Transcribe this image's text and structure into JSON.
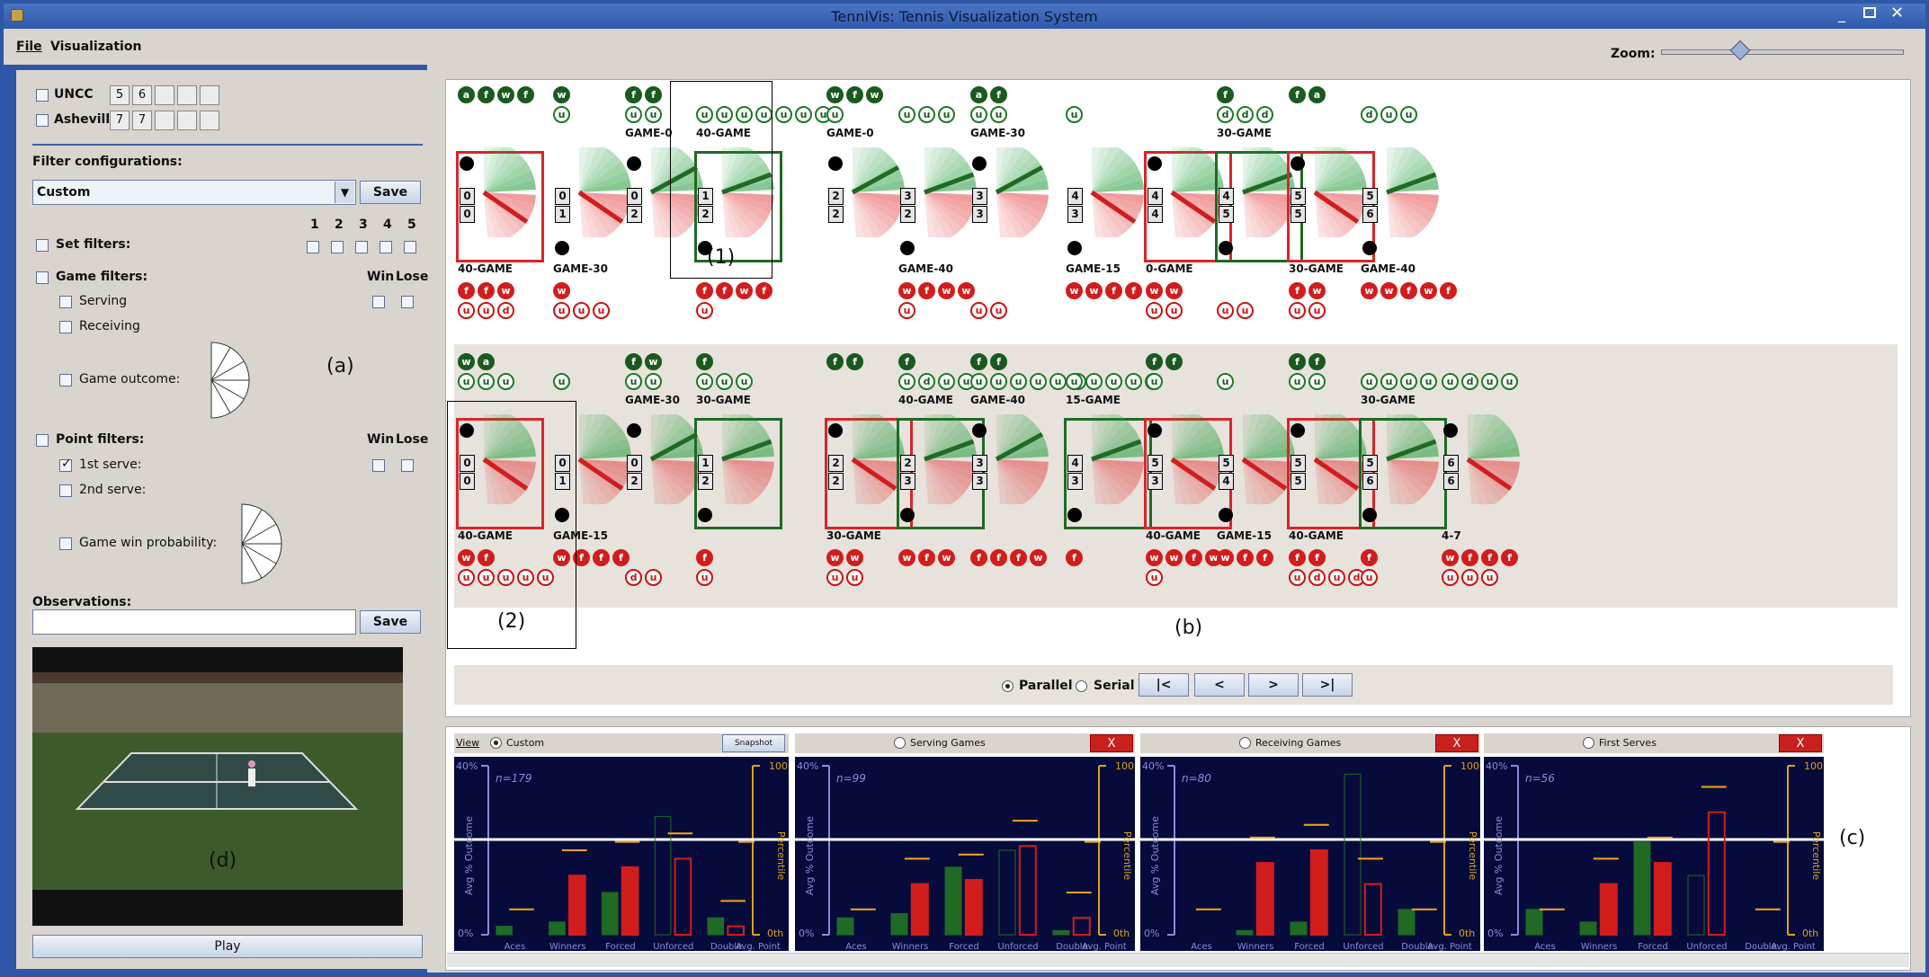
{
  "window": {
    "title": "TenniVis:  Tennis Visualization System"
  },
  "menu": {
    "file": "File",
    "visualization": "Visualization",
    "zoom_label": "Zoom:",
    "zoom_level": 0.28
  },
  "players": [
    {
      "name": "UNCC",
      "sets": [
        "5",
        "6",
        "",
        "",
        ""
      ]
    },
    {
      "name": "Asheville",
      "sets": [
        "7",
        "7",
        "",
        "",
        ""
      ]
    }
  ],
  "filters": {
    "config_label": "Filter configurations:",
    "config_value": "Custom",
    "save": "Save",
    "set_numbers": [
      "1",
      "2",
      "3",
      "4",
      "5"
    ],
    "set_filters": "Set filters:",
    "game_filters": "Game filters:",
    "win": "Win",
    "lose": "Lose",
    "serving": "Serving",
    "receiving": "Receiving",
    "game_outcome": "Game outcome:",
    "point_filters": "Point filters:",
    "first_serve": "1st serve:",
    "second_serve": "2nd serve:",
    "game_win_prob": "Game win probability:",
    "observations": "Observations:",
    "obs_save": "Save",
    "play": "Play"
  },
  "annotations": {
    "a": "(a)",
    "b": "(b)",
    "c": "(c)",
    "d": "(d)",
    "one": "(1)",
    "two": "(2)"
  },
  "colors": {
    "win": "#1a5a1f",
    "lose": "#d21d1d",
    "bg": "#d9d4ce"
  },
  "sets": [
    {
      "games": [
        {
          "x": 372,
          "top": [
            "a",
            "f",
            "w",
            "f"
          ],
          "topO": [],
          "title": "",
          "score": [
            "0",
            "0"
          ],
          "box": "r",
          "serveTop": true,
          "bottomLbl": "40-GAME",
          "bot": [
            "f",
            "f",
            "w"
          ],
          "botO": [
            "u",
            "u",
            "d"
          ],
          "fan": "rd"
        },
        {
          "x": 478,
          "top": [
            "w"
          ],
          "topO": [
            "u"
          ],
          "title": "",
          "score": [
            "0",
            "1"
          ],
          "box": "",
          "serveTop": false,
          "bottomLbl": "GAME-30",
          "bot": [
            "w"
          ],
          "botO": [
            "u",
            "u",
            "u"
          ],
          "fan": "rd"
        },
        {
          "x": 558,
          "top": [
            "f",
            "f"
          ],
          "topO": [
            "u",
            "u"
          ],
          "title": "GAME-0",
          "score": [
            "0",
            "2"
          ],
          "box": "",
          "serveTop": true,
          "bottomLbl": "",
          "bot": [],
          "botO": [],
          "fan": "gu"
        },
        {
          "x": 637,
          "top": [],
          "topO": [
            "u",
            "u",
            "u",
            "u",
            "u",
            "u",
            "u"
          ],
          "title": "40-GAME",
          "score": [
            "1",
            "2"
          ],
          "box": "g",
          "serveTop": false,
          "bottomLbl": "",
          "bot": [
            "f",
            "f",
            "w",
            "f"
          ],
          "botO": [
            "u"
          ],
          "fan": "gl"
        },
        {
          "x": 782,
          "top": [
            "w",
            "f",
            "w"
          ],
          "topO": [
            "u"
          ],
          "title": "GAME-0",
          "score": [
            "2",
            "2"
          ],
          "box": "",
          "serveTop": true,
          "bottomLbl": "",
          "bot": [],
          "botO": [],
          "fan": "gu"
        },
        {
          "x": 862,
          "top": [],
          "topO": [
            "u",
            "u",
            "u"
          ],
          "title": "",
          "score": [
            "3",
            "2"
          ],
          "box": "",
          "serveTop": false,
          "bottomLbl": "GAME-40",
          "bot": [
            "w",
            "f",
            "w",
            "w"
          ],
          "botO": [
            "u"
          ],
          "fan": "gl"
        },
        {
          "x": 942,
          "top": [
            "a",
            "f"
          ],
          "topO": [
            "u",
            "u"
          ],
          "title": "GAME-30",
          "score": [
            "3",
            "3"
          ],
          "box": "",
          "serveTop": true,
          "bottomLbl": "",
          "bot": [],
          "botO": [
            "u",
            "u"
          ],
          "fan": "gu"
        },
        {
          "x": 1048,
          "top": [],
          "topO": [
            "u"
          ],
          "title": "",
          "score": [
            "4",
            "3"
          ],
          "box": "",
          "serveTop": false,
          "bottomLbl": "GAME-15",
          "bot": [
            "w",
            "w",
            "f",
            "f"
          ],
          "botO": [],
          "fan": "rd"
        },
        {
          "x": 1137,
          "top": [],
          "topO": [],
          "title": "",
          "score": [
            "4",
            "4"
          ],
          "box": "r",
          "serveTop": true,
          "bottomLbl": "0-GAME",
          "bot": [
            "w",
            "w"
          ],
          "botO": [
            "u",
            "u"
          ],
          "fan": "rd"
        },
        {
          "x": 1216,
          "top": [
            "f"
          ],
          "topO": [
            "d",
            "d",
            "d"
          ],
          "title": "30-GAME",
          "score": [
            "4",
            "5"
          ],
          "box": "g",
          "serveTop": false,
          "bottomLbl": "",
          "bot": [],
          "botO": [
            "u",
            "u"
          ],
          "fan": "gl"
        },
        {
          "x": 1296,
          "top": [
            "f",
            "a"
          ],
          "topO": [],
          "title": "",
          "score": [
            "5",
            "5"
          ],
          "box": "r",
          "serveTop": true,
          "bottomLbl": "30-GAME",
          "bot": [
            "f",
            "w"
          ],
          "botO": [
            "u",
            "u"
          ],
          "fan": "rd"
        },
        {
          "x": 1376,
          "top": [],
          "topO": [
            "d",
            "u",
            "u"
          ],
          "title": "",
          "score": [
            "5",
            "6"
          ],
          "box": "",
          "serveTop": false,
          "bottomLbl": "GAME-40",
          "bot": [
            "w",
            "w",
            "f",
            "w",
            "f"
          ],
          "botO": [],
          "fan": "gl"
        }
      ]
    },
    {
      "games": [
        {
          "x": 372,
          "top": [
            "w",
            "a"
          ],
          "topO": [
            "u",
            "u",
            "u"
          ],
          "title": "",
          "score": [
            "0",
            "0"
          ],
          "box": "r",
          "serveTop": true,
          "bottomLbl": "40-GAME",
          "bot": [
            "w",
            "f"
          ],
          "botO": [
            "u",
            "u",
            "u",
            "u",
            "u"
          ],
          "fan": "rd"
        },
        {
          "x": 478,
          "top": [],
          "topO": [
            "u"
          ],
          "title": "",
          "score": [
            "0",
            "1"
          ],
          "box": "",
          "serveTop": false,
          "bottomLbl": "GAME-15",
          "bot": [
            "w",
            "f",
            "f",
            "f"
          ],
          "botO": [],
          "fan": "rd"
        },
        {
          "x": 558,
          "top": [
            "f",
            "w"
          ],
          "topO": [
            "u",
            "u"
          ],
          "title": "GAME-30",
          "score": [
            "0",
            "2"
          ],
          "box": "",
          "serveTop": true,
          "bottomLbl": "",
          "bot": [],
          "botO": [
            "d",
            "u"
          ],
          "fan": "gu"
        },
        {
          "x": 637,
          "top": [
            "f"
          ],
          "topO": [
            "u",
            "u",
            "u"
          ],
          "title": "30-GAME",
          "score": [
            "1",
            "2"
          ],
          "box": "g",
          "serveTop": false,
          "bottomLbl": "",
          "bot": [
            "f"
          ],
          "botO": [
            "u"
          ],
          "fan": "gl"
        },
        {
          "x": 782,
          "top": [
            "f",
            "f"
          ],
          "topO": [],
          "title": "",
          "score": [
            "2",
            "2"
          ],
          "box": "r",
          "serveTop": true,
          "bottomLbl": "30-GAME",
          "bot": [
            "w",
            "w"
          ],
          "botO": [
            "u",
            "u"
          ],
          "fan": "rd"
        },
        {
          "x": 862,
          "top": [
            "f"
          ],
          "topO": [
            "u",
            "d",
            "u",
            "u"
          ],
          "title": "40-GAME",
          "score": [
            "2",
            "3"
          ],
          "box": "g",
          "serveTop": false,
          "bottomLbl": "",
          "bot": [
            "w",
            "f",
            "w"
          ],
          "botO": [],
          "fan": "gl"
        },
        {
          "x": 942,
          "top": [
            "f",
            "f"
          ],
          "topO": [
            "u",
            "u",
            "u",
            "u",
            "u",
            "u"
          ],
          "title": "GAME-40",
          "score": [
            "3",
            "3"
          ],
          "box": "",
          "serveTop": true,
          "bottomLbl": "",
          "bot": [
            "f",
            "f",
            "f",
            "w"
          ],
          "botO": [],
          "fan": "gu"
        },
        {
          "x": 1048,
          "top": [],
          "topO": [
            "u",
            "u",
            "u",
            "u",
            "u"
          ],
          "title": "15-GAME",
          "score": [
            "4",
            "3"
          ],
          "box": "g",
          "serveTop": false,
          "bottomLbl": "",
          "bot": [
            "f"
          ],
          "botO": [],
          "fan": "gl"
        },
        {
          "x": 1137,
          "top": [
            "f",
            "f"
          ],
          "topO": [
            "u"
          ],
          "title": "",
          "score": [
            "5",
            "3"
          ],
          "box": "r",
          "serveTop": true,
          "bottomLbl": "40-GAME",
          "bot": [
            "w",
            "w",
            "f",
            "w"
          ],
          "botO": [
            "u"
          ],
          "fan": "rd"
        },
        {
          "x": 1216,
          "top": [],
          "topO": [
            "u"
          ],
          "title": "",
          "score": [
            "5",
            "4"
          ],
          "box": "",
          "serveTop": false,
          "bottomLbl": "GAME-15",
          "bot": [
            "w",
            "f",
            "f"
          ],
          "botO": [],
          "fan": "rd"
        },
        {
          "x": 1296,
          "top": [
            "f",
            "f"
          ],
          "topO": [
            "u",
            "u"
          ],
          "title": "",
          "score": [
            "5",
            "5"
          ],
          "box": "r",
          "serveTop": true,
          "bottomLbl": "40-GAME",
          "bot": [
            "f",
            "f"
          ],
          "botO": [
            "u",
            "d",
            "u",
            "d"
          ],
          "fan": "rd"
        },
        {
          "x": 1376,
          "top": [],
          "topO": [
            "u",
            "u",
            "u",
            "u"
          ],
          "title": "30-GAME",
          "score": [
            "5",
            "6"
          ],
          "box": "g",
          "serveTop": false,
          "bottomLbl": "",
          "bot": [
            "f"
          ],
          "botO": [
            "u"
          ],
          "fan": "gl"
        },
        {
          "x": 1466,
          "top": [],
          "topO": [
            "u",
            "d",
            "u",
            "u"
          ],
          "title": "",
          "score": [
            "6",
            "6"
          ],
          "box": "",
          "serveTop": true,
          "bottomLbl": "4-7",
          "bot": [
            "w",
            "f",
            "f",
            "f"
          ],
          "botO": [
            "u",
            "u",
            "u"
          ],
          "fan": "rd"
        }
      ]
    }
  ],
  "controls": {
    "parallel": "Parallel",
    "serial": "Serial",
    "first": "|<",
    "prev": "<",
    "next": ">",
    "last": ">|"
  },
  "stat_panels": [
    {
      "header": "Custom",
      "view": "View",
      "snapshot": "Snapshot",
      "n": "n=179",
      "close": ""
    },
    {
      "header": "Serving Games",
      "n": "n=99",
      "close": "X"
    },
    {
      "header": "Receiving Games",
      "n": "n=80",
      "close": "X"
    },
    {
      "header": "First Serves",
      "n": "n=56",
      "close": "X"
    }
  ],
  "stat_axis": {
    "y_left": "Avg % Outcome",
    "y_right": "Percentile",
    "top_left": "40%",
    "bottom_left": "0%",
    "top_right": "100",
    "bottom_right": "0th",
    "categories": [
      "Aces",
      "Winners",
      "Forced",
      "Unforced",
      "Double",
      "Avg. Point"
    ]
  },
  "chart_data": [
    {
      "type": "bar",
      "title": "Custom",
      "categories": [
        "Aces",
        "Winners",
        "Forced",
        "Unforced",
        "Double"
      ],
      "series": [],
      "green": [
        2,
        3,
        10,
        28,
        4
      ],
      "red": [
        0,
        14,
        16,
        18,
        2
      ],
      "ylim": [
        0,
        40
      ]
    },
    {
      "type": "bar",
      "title": "Serving Games",
      "categories": [
        "Aces",
        "Winners",
        "Forced",
        "Unforced",
        "Double"
      ],
      "series": [],
      "green": [
        4,
        5,
        16,
        20,
        1
      ],
      "red": [
        0,
        12,
        13,
        21,
        4
      ],
      "ylim": [
        0,
        40
      ]
    },
    {
      "type": "bar",
      "title": "Receiving Games",
      "categories": [
        "Aces",
        "Winners",
        "Forced",
        "Unforced",
        "Double"
      ],
      "series": [],
      "green": [
        0,
        1,
        3,
        38,
        6
      ],
      "red": [
        0,
        17,
        20,
        12,
        0
      ],
      "ylim": [
        0,
        40
      ]
    },
    {
      "type": "bar",
      "title": "First Serves",
      "categories": [
        "Aces",
        "Winners",
        "Forced",
        "Unforced",
        "Double"
      ],
      "series": [],
      "green": [
        6,
        3,
        22,
        14,
        0
      ],
      "red": [
        0,
        12,
        17,
        29,
        0
      ],
      "ylim": [
        0,
        40
      ]
    }
  ]
}
